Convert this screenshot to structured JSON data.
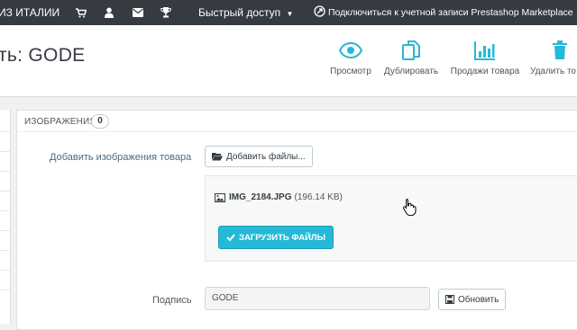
{
  "topbar": {
    "shop_label": "ИЗ ИТАЛИИ",
    "quick_access": "Быстрый доступ",
    "marketplace": "Подключиться к учетной записи Prestashop Marketplace"
  },
  "header": {
    "title": "ть: GODE"
  },
  "toolbar": {
    "preview": "Просмотр",
    "duplicate": "Дублировать",
    "sales": "Продажи товара",
    "delete": "Удалить то"
  },
  "images_panel": {
    "title": "ИЗОБРАЖЕНИЯ",
    "count": "0",
    "add_label": "Добавить изображения товара",
    "add_files_button": "Добавить файлы...",
    "file_name": "IMG_2184.JPG",
    "file_size": "(196.14 KB)",
    "upload_button": "ЗАГРУЗИТЬ ФАЙЛЫ"
  },
  "caption_field": {
    "label": "Подпись",
    "value": "GODE",
    "update_button": "Обновить"
  },
  "colors": {
    "topbar": "#363a41",
    "accent": "#25b9d7"
  }
}
